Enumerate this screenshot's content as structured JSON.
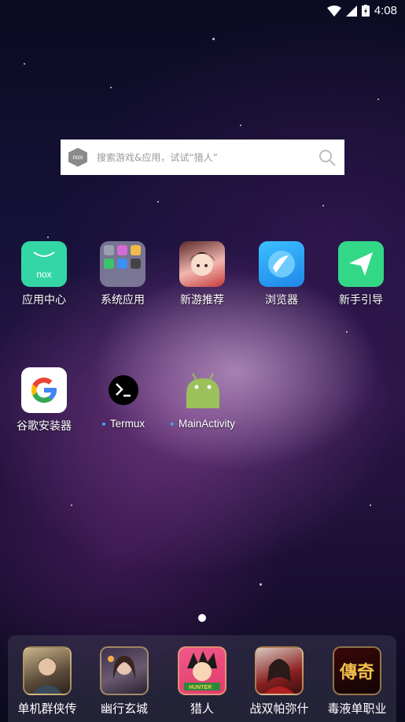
{
  "status_bar": {
    "time": "4:08",
    "icons": [
      "wifi-icon",
      "cell-signal-icon",
      "battery-charging-icon"
    ]
  },
  "search": {
    "logo_text": "nox",
    "placeholder": "搜索游戏&应用，试试“猎人”"
  },
  "home_apps": [
    {
      "label": "应用中心",
      "icon": "nox-app-center-icon",
      "color": "#35d6a6"
    },
    {
      "label": "系统应用",
      "icon": "system-apps-folder-icon",
      "color": "#8a8ca8"
    },
    {
      "label": "新游推荐",
      "icon": "new-games-icon",
      "color": "#f2b7b0"
    },
    {
      "label": "浏览器",
      "icon": "browser-icon",
      "color": "#2fa6f0"
    },
    {
      "label": "新手引导",
      "icon": "guide-icon",
      "color": "#33d887"
    },
    {
      "label": "谷歌安装器",
      "icon": "google-icon",
      "color": "#ffffff"
    },
    {
      "label": "Termux",
      "icon": "termux-icon",
      "color": "#000000"
    },
    {
      "label": "MainActivity",
      "icon": "android-icon",
      "color": "#9bc15a"
    }
  ],
  "dock_apps": [
    {
      "label": "单机群侠传",
      "icon": "game-hero-icon"
    },
    {
      "label": "幽行玄城",
      "icon": "game-girl-icon"
    },
    {
      "label": "猎人",
      "icon": "game-hunter-icon"
    },
    {
      "label": "战双帕弥什",
      "icon": "game-punishing-icon"
    },
    {
      "label": "毒液单职业",
      "icon": "game-chuanqi-icon"
    }
  ],
  "dock_chuanqi_text": "傳奇",
  "dock_hunter_text": "HUNTER"
}
